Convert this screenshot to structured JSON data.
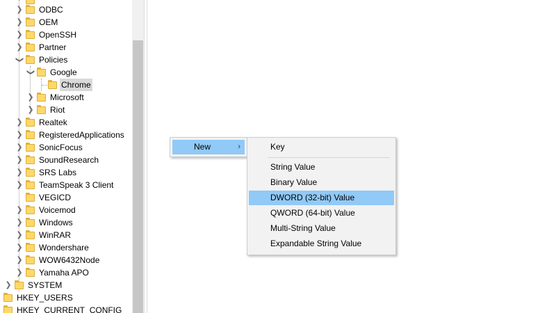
{
  "tree": {
    "items": [
      {
        "label": "ODBC",
        "expanded": false,
        "selected": false
      },
      {
        "label": "OEM",
        "expanded": false,
        "selected": false
      },
      {
        "label": "OpenSSH",
        "expanded": false,
        "selected": false
      },
      {
        "label": "Partner",
        "expanded": false,
        "selected": false
      },
      {
        "label": "Policies",
        "expanded": true,
        "selected": false
      },
      {
        "label": "Google",
        "expanded": true,
        "selected": false
      },
      {
        "label": "Chrome",
        "expanded": false,
        "selected": true
      },
      {
        "label": "Microsoft",
        "expanded": false,
        "selected": false
      },
      {
        "label": "Riot",
        "expanded": false,
        "selected": false
      },
      {
        "label": "Realtek",
        "expanded": false,
        "selected": false
      },
      {
        "label": "RegisteredApplications",
        "expanded": false,
        "selected": false
      },
      {
        "label": "SonicFocus",
        "expanded": false,
        "selected": false
      },
      {
        "label": "SoundResearch",
        "expanded": false,
        "selected": false
      },
      {
        "label": "SRS Labs",
        "expanded": false,
        "selected": false
      },
      {
        "label": "TeamSpeak 3 Client",
        "expanded": false,
        "selected": false
      },
      {
        "label": "VEGICD",
        "expanded": false,
        "selected": false
      },
      {
        "label": "Voicemod",
        "expanded": false,
        "selected": false
      },
      {
        "label": "Windows",
        "expanded": false,
        "selected": false
      },
      {
        "label": "WinRAR",
        "expanded": false,
        "selected": false
      },
      {
        "label": "Wondershare",
        "expanded": false,
        "selected": false
      },
      {
        "label": "WOW6432Node",
        "expanded": false,
        "selected": false
      },
      {
        "label": "Yamaha APO",
        "expanded": false,
        "selected": false
      },
      {
        "label": "SYSTEM",
        "expanded": false,
        "selected": false
      },
      {
        "label": "HKEY_USERS",
        "expanded": false,
        "selected": false
      },
      {
        "label": "HKEY_CURRENT_CONFIG",
        "expanded": false,
        "selected": false
      }
    ]
  },
  "context_menu": {
    "new_label": "New",
    "new_arrow": "›"
  },
  "submenu": {
    "key": "Key",
    "string_value": "String Value",
    "binary_value": "Binary Value",
    "dword_value": "DWORD (32-bit) Value",
    "qword_value": "QWORD (64-bit) Value",
    "multi_string_value": "Multi-String Value",
    "expandable_string_value": "Expandable String Value"
  },
  "colors": {
    "highlight": "#91c9f7",
    "folder": "#ffd86a",
    "selected_bg": "#d9d9d9"
  },
  "icons": {
    "tree_expand": "chevron-right-icon",
    "tree_collapse": "chevron-down-icon",
    "folder": "folder-icon",
    "submenu_arrow": "chevron-right-icon"
  }
}
